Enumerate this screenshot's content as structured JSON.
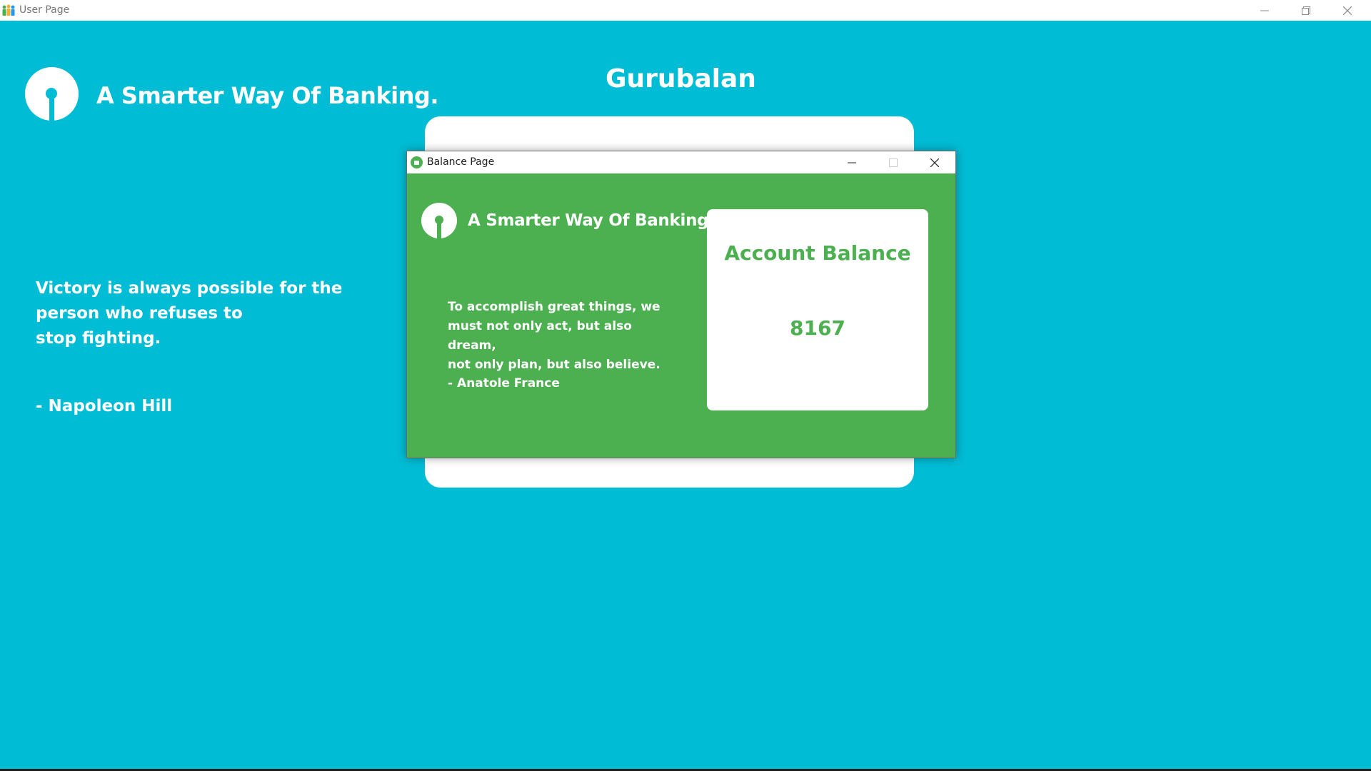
{
  "colors": {
    "main_background": "#00bcd4",
    "dialog_background": "#4caf50",
    "card_background": "#ffffff",
    "accent_text": "#4caf50"
  },
  "main_window": {
    "title": "User Page",
    "icon": "app-people-icon",
    "controls": {
      "minimize": "minimize-icon",
      "maximize": "restore-icon",
      "close": "close-icon"
    },
    "tagline": "A Smarter Way Of Banking.",
    "username": "Gurubalan",
    "quote": {
      "line1": "Victory is always possible for the",
      "line2": "person who refuses to",
      "line3": "stop fighting.",
      "author": "- Napoleon Hill"
    }
  },
  "balance_window": {
    "title": "Balance Page",
    "icon": "lock-icon",
    "controls": {
      "minimize": "minimize-icon",
      "maximize": "maximize-icon",
      "close": "close-icon"
    },
    "tagline": "A Smarter Way Of Banking.",
    "quote": {
      "line1": "To accomplish great things, we",
      "line2": "must not only act, but also dream,",
      "line3": "not only plan, but also believe.",
      "author": "- Anatole France"
    },
    "balance_card": {
      "heading": "Account Balance",
      "value": "8167"
    }
  }
}
